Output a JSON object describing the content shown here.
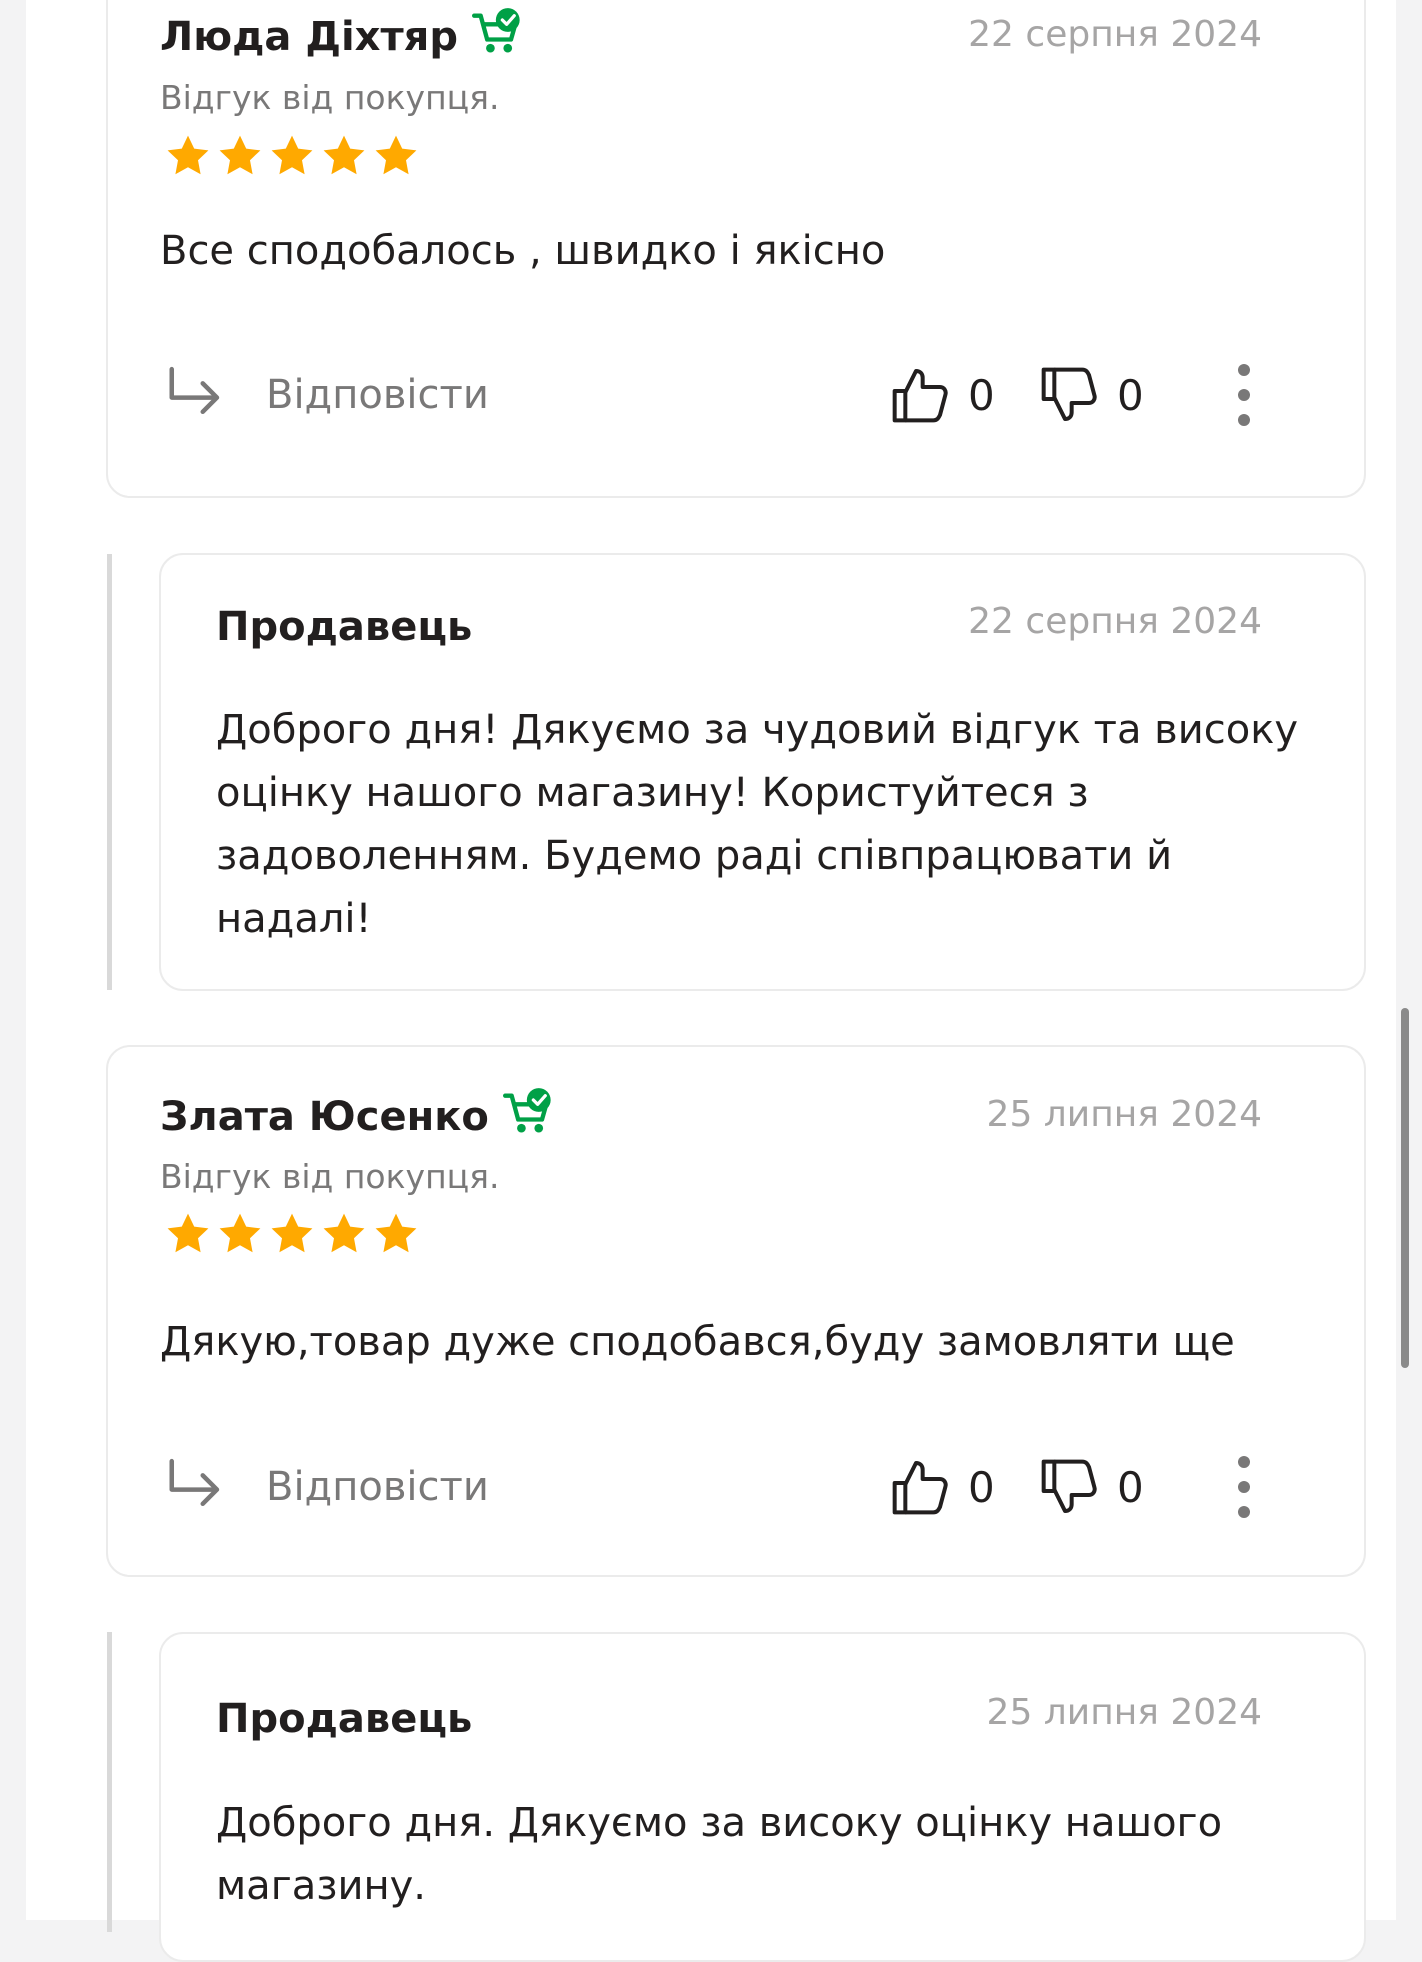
{
  "reviews": [
    {
      "author": "Люда Діхтяр",
      "date": "22 серпня 2024",
      "subtitle": "Відгук від покупця.",
      "rating": 5,
      "text": "Все сподобалось , швидко і якісно",
      "reply_label": "Відповісти",
      "likes": "0",
      "dislikes": "0",
      "seller_reply": {
        "author": "Продавець",
        "date": "22 серпня 2024",
        "text": "Доброго дня! Дякуємо за чудовий відгук та високу оцінку нашого магазину! Користуйтеся з задоволенням. Будемо раді співпрацювати й надалі!"
      }
    },
    {
      "author": "Злата Юсенко",
      "date": "25 липня 2024",
      "subtitle": "Відгук від покупця.",
      "rating": 5,
      "text": "Дякую,товар дуже сподобався,буду замовляти ще",
      "reply_label": "Відповісти",
      "likes": "0",
      "dislikes": "0",
      "seller_reply": {
        "author": "Продавець",
        "date": "25 липня 2024",
        "text": "Доброго дня. Дякуємо за високу оцінку нашого магазину."
      }
    }
  ],
  "colors": {
    "star": "#ffa900",
    "verified": "#00a046",
    "muted_text": "#797878",
    "date_text": "#a6a5a5",
    "main_text": "#221f1f"
  },
  "icons": {
    "verified": "verified-buyer-cart-icon",
    "star": "star-icon",
    "reply": "reply-arrow-icon",
    "like": "thumbs-up-icon",
    "dislike": "thumbs-down-icon",
    "more": "more-vertical-icon"
  }
}
